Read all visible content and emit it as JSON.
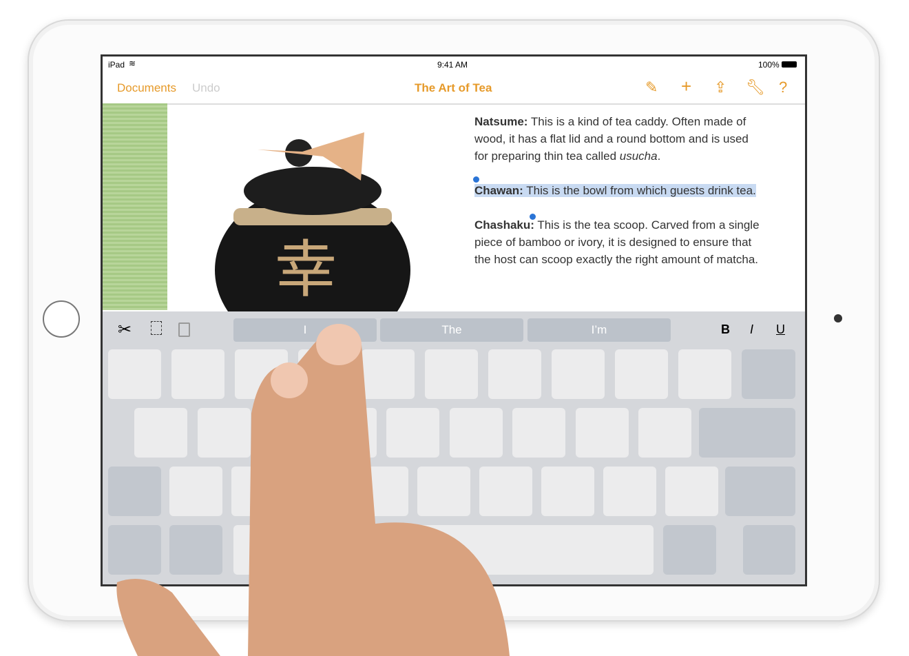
{
  "status": {
    "device": "iPad",
    "time": "9:41 AM",
    "battery": "100%"
  },
  "nav": {
    "documents": "Documents",
    "undo": "Undo",
    "title": "The Art of Tea",
    "accent": "#e69a2a"
  },
  "toolbar_icons": [
    "paintbrush-icon",
    "plus-icon",
    "share-icon",
    "wrench-icon",
    "help-icon"
  ],
  "doc": {
    "p1_term": "Natsume:",
    "p1_text": " This is a kind of tea caddy. Often made of wood, it has a flat lid and a round bottom and is used for preparing thin tea called ",
    "p1_em": "usucha",
    "p1_end": ".",
    "p2_term": "Chawan:",
    "p2_text": " This is the bowl from which guests drink tea.",
    "p3_term": "Chashaku:",
    "p3_text": " This is the tea scoop. Carved from a single piece of bamboo or ivory, it is designed to ensure that the host can scoop exactly the right amount of matcha."
  },
  "keyboard": {
    "suggestions": [
      "I",
      "The",
      "I’m"
    ],
    "bold": "B",
    "italic": "I",
    "underline": "U"
  }
}
